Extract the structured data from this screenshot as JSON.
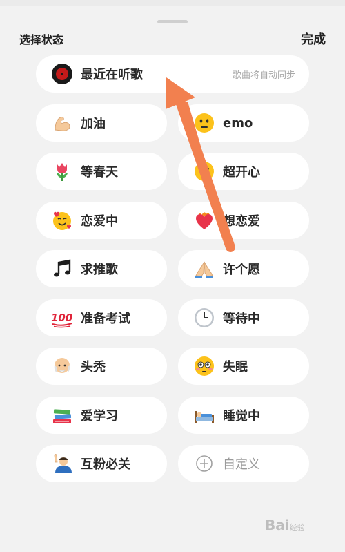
{
  "header": {
    "title": "选择状态",
    "done_label": "完成"
  },
  "listening": {
    "label": "最近在听歌",
    "hint": "歌曲将自动同步",
    "icon": "record-icon"
  },
  "statuses": [
    {
      "label": "加油",
      "icon": "flexed-biceps-icon"
    },
    {
      "label": "emo",
      "icon": "neutral-face-icon"
    },
    {
      "label": "等春天",
      "icon": "tulip-icon"
    },
    {
      "label": "超开心",
      "icon": "grinning-face-icon"
    },
    {
      "label": "恋爱中",
      "icon": "smiling-face-with-hearts-icon"
    },
    {
      "label": "想恋爱",
      "icon": "heart-on-fire-icon"
    },
    {
      "label": "求推歌",
      "icon": "music-notes-icon"
    },
    {
      "label": "许个愿",
      "icon": "folded-hands-icon"
    },
    {
      "label": "准备考试",
      "icon": "hundred-points-icon"
    },
    {
      "label": "等待中",
      "icon": "clock-icon"
    },
    {
      "label": "头秃",
      "icon": "bald-man-icon"
    },
    {
      "label": "失眠",
      "icon": "flushed-face-icon"
    },
    {
      "label": "爱学习",
      "icon": "books-icon"
    },
    {
      "label": "睡觉中",
      "icon": "person-in-bed-icon"
    },
    {
      "label": "互粉必关",
      "icon": "person-raising-hand-icon"
    },
    {
      "label": "自定义",
      "icon": "plus-circle-icon"
    }
  ],
  "watermark": {
    "text": "Bai",
    "suffix": "经验"
  },
  "colors": {
    "arrow": "#f2804f",
    "background": "#f2f2f2",
    "pill": "#ffffff"
  }
}
